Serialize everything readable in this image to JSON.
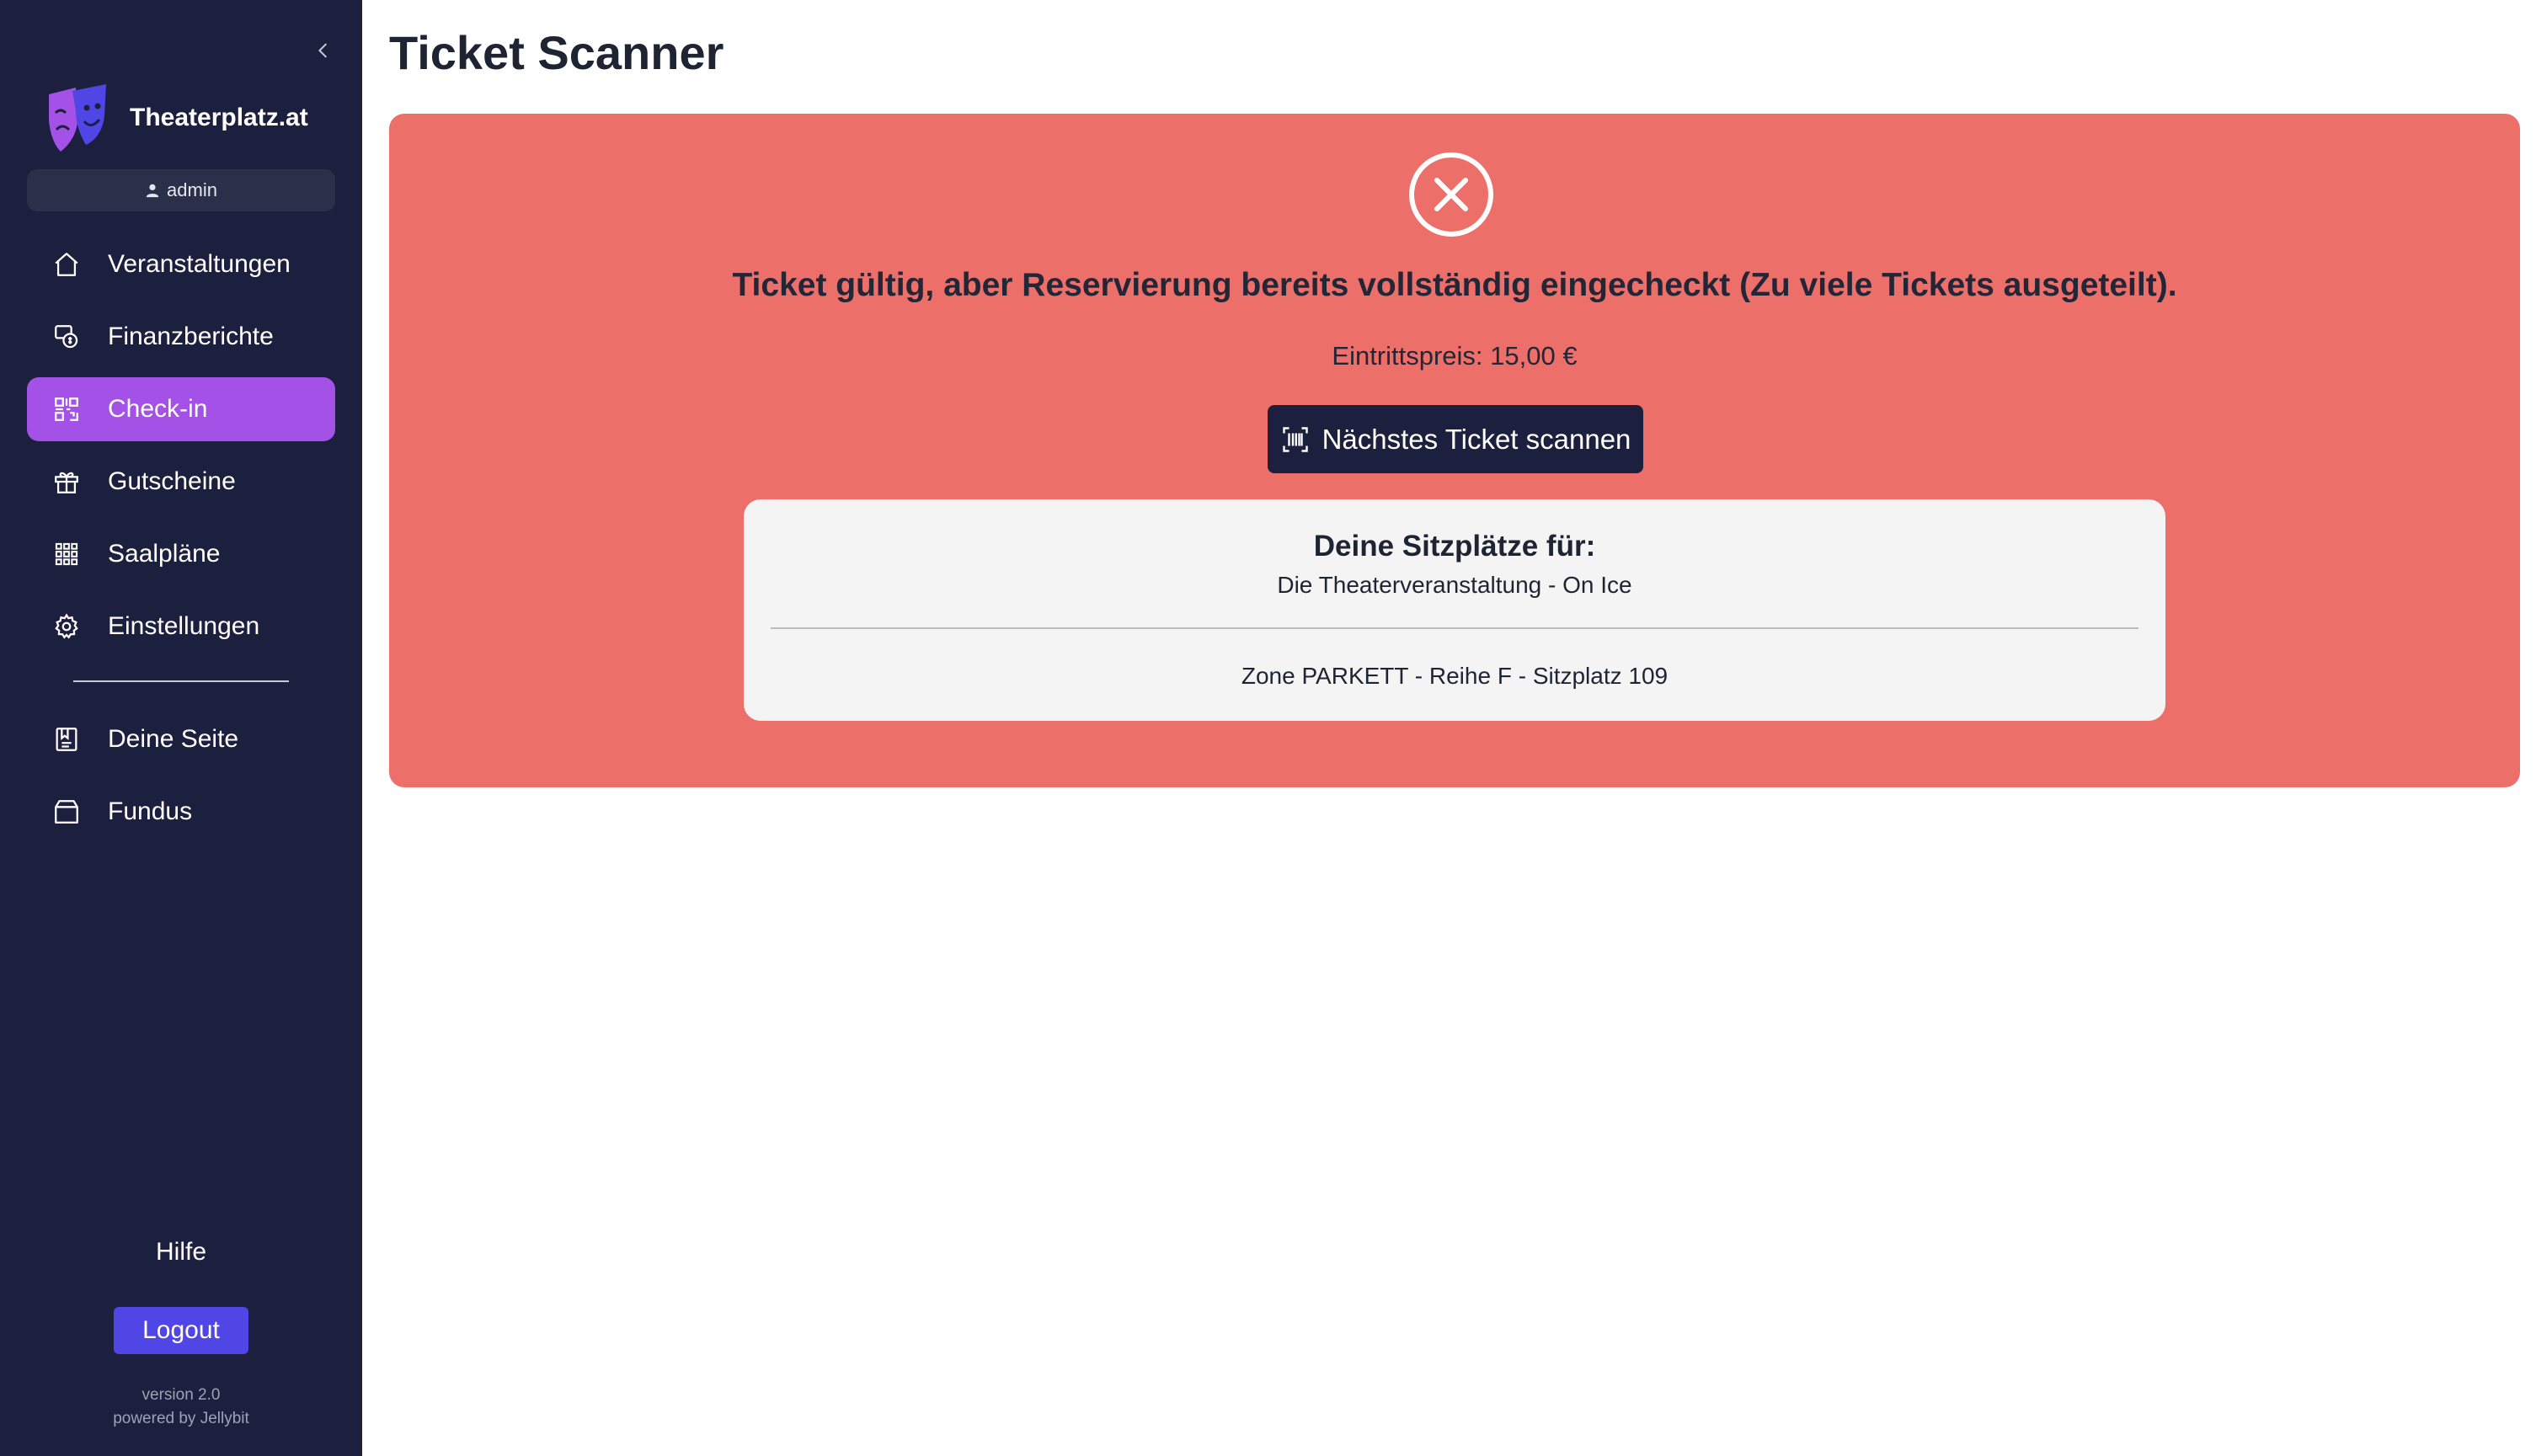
{
  "app": {
    "brand_name": "Theaterplatz.at",
    "user": "admin"
  },
  "sidebar": {
    "items": [
      {
        "label": "Veranstaltungen",
        "icon": "home-icon"
      },
      {
        "label": "Finanzberichte",
        "icon": "finance-report-icon"
      },
      {
        "label": "Check-in",
        "icon": "qr-code-icon",
        "active": true
      },
      {
        "label": "Gutscheine",
        "icon": "gift-icon"
      },
      {
        "label": "Saalpläne",
        "icon": "grid-icon"
      },
      {
        "label": "Einstellungen",
        "icon": "gear-icon"
      }
    ],
    "items2": [
      {
        "label": "Deine Seite",
        "icon": "page-icon"
      },
      {
        "label": "Fundus",
        "icon": "box-icon"
      }
    ],
    "help_label": "Hilfe",
    "logout_label": "Logout",
    "version": "version 2.0",
    "powered_by": "powered by Jellybit"
  },
  "main": {
    "title": "Ticket Scanner",
    "alert": {
      "message": "Ticket gültig, aber Reservierung bereits vollständig eingecheckt (Zu viele Tickets ausgeteilt).",
      "price": "Eintrittspreis: 15,00 €",
      "scan_button": "Nächstes Ticket scannen",
      "color": "#ed6f6a"
    },
    "seats": {
      "title": "Deine Sitzplätze für:",
      "event": "Die Theaterveranstaltung - On Ice",
      "seat": "Zone PARKETT - Reihe F - Sitzplatz 109"
    }
  },
  "colors": {
    "sidebar_bg": "#1c1f3d",
    "accent": "#a451e8",
    "logout": "#4f46e5",
    "alert": "#ed6f6a"
  }
}
